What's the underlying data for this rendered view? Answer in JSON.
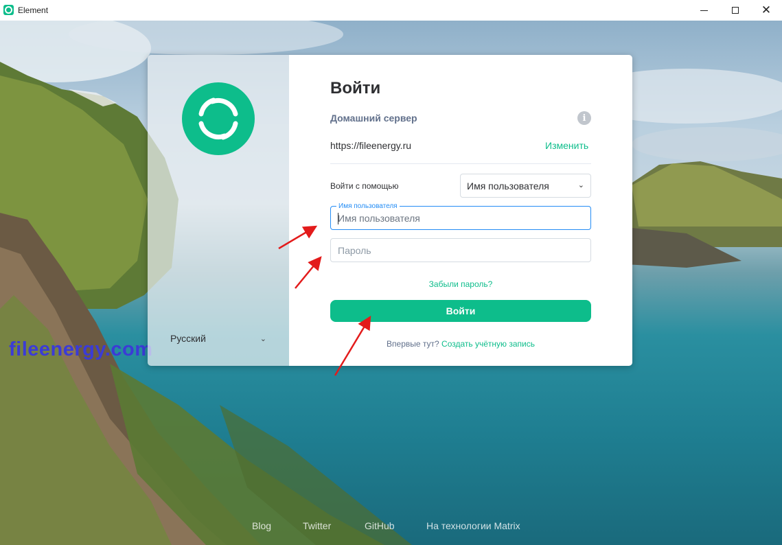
{
  "window": {
    "title": "Element",
    "accent": "#0dbd8b"
  },
  "card": {
    "language": "Русский",
    "title": "Войти",
    "homeserver_label": "Домашний сервер",
    "homeserver_url": "https://fileenergy.ru",
    "change_label": "Изменить",
    "login_with_label": "Войти с помощью",
    "login_with_selected": "Имя пользователя",
    "username_label": "Имя пользователя",
    "username_placeholder": "Имя пользователя",
    "password_placeholder": "Пароль",
    "forgot_password": "Забыли пароль?",
    "sign_in_button": "Войти",
    "new_here": "Впервые тут?",
    "create_account": "Создать учётную запись"
  },
  "watermark": "fileenergy.com",
  "footer": {
    "links": [
      "Blog",
      "Twitter",
      "GitHub",
      "На технологии Matrix"
    ]
  },
  "icons": {
    "app": "element-logo-icon",
    "info": "info-icon",
    "chevron": "chevron-down-icon"
  }
}
